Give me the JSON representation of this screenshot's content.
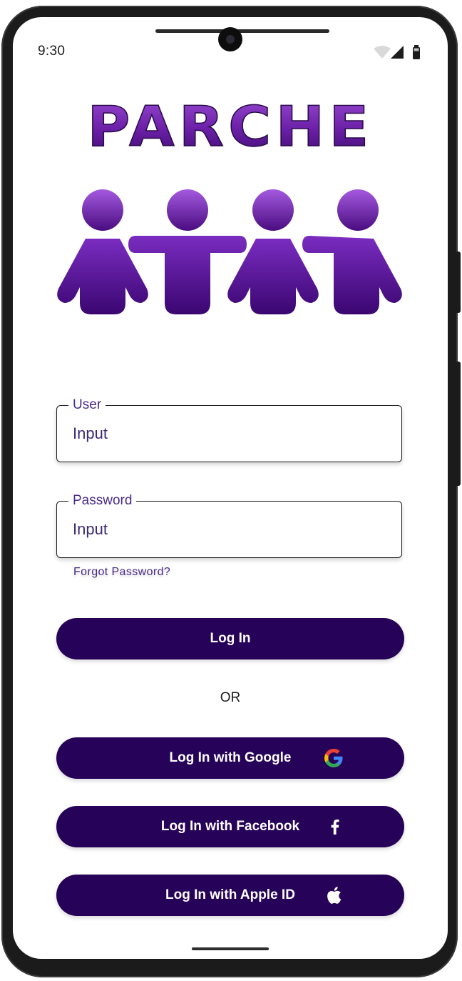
{
  "status_bar": {
    "time": "9:30"
  },
  "app": {
    "logo_text": "PARCHE"
  },
  "form": {
    "user": {
      "label": "User",
      "value": "Input"
    },
    "password": {
      "label": "Password",
      "value": "Input"
    },
    "forgot_password": "Forgot Password?"
  },
  "buttons": {
    "login": "Log In",
    "or": "OR",
    "google": "Log In with Google",
    "facebook": "Log In with Facebook",
    "apple": "Log In with Apple ID"
  },
  "colors": {
    "primary": "#260359",
    "brand_purple": "#6a1fa6",
    "label_purple": "#4a2c8a"
  },
  "icons": [
    "signal-icon",
    "wifi-icon",
    "battery-icon",
    "google-icon",
    "facebook-icon",
    "apple-icon",
    "people-logo-icon"
  ]
}
